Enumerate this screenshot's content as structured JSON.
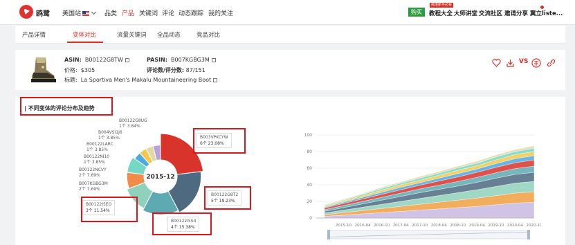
{
  "header": {
    "brand": "鸥鹭",
    "site_label": "美国站",
    "nav": [
      {
        "label": "品类",
        "active": false
      },
      {
        "label": "产品",
        "active": true
      },
      {
        "label": "关键词",
        "active": false
      },
      {
        "label": "评论",
        "active": false
      },
      {
        "label": "动态跟踪",
        "active": false
      },
      {
        "label": "我的关注",
        "active": false
      }
    ],
    "buy_label": "购买",
    "promo_tag": "跨境新手必看",
    "right_nav": [
      "教程大全",
      "大师讲堂",
      "交流社区",
      "邀请分享",
      "翼立liste..."
    ]
  },
  "subnav": {
    "tabs": [
      "产品详情",
      "变体对比",
      "流量关键词",
      "全品动态",
      "竞品对比"
    ],
    "active_index": 1
  },
  "product": {
    "asin_label": "ASIN:",
    "asin": "B00122G8TW",
    "pasin_label": "PASIN:",
    "pasin": "B007KGBG3M",
    "price_label": "价格:",
    "price": "$305",
    "reviews_label": "评论数/评分数:",
    "reviews": "87/151",
    "title_label": "标题:",
    "title": "La Sportiva Men's Makalu Mountaineering Boot",
    "vs_label": "VS"
  },
  "section": {
    "title": "不同变体的评论分布及趋势"
  },
  "chart_data": [
    {
      "type": "pie",
      "center_label": "2015-12",
      "slices": [
        {
          "name": "B003VPKCYW",
          "count": "6个",
          "percent": "23.08%",
          "value": 23.08,
          "color": "#d9342b"
        },
        {
          "name": "B00122G8T2",
          "count": "5个",
          "percent": "19.23%",
          "value": 19.23,
          "color": "#4d6a80"
        },
        {
          "name": "B00122I5S4",
          "count": "4个",
          "percent": "15.38%",
          "value": 15.38,
          "color": "#5eaab3"
        },
        {
          "name": "B00122I5EO",
          "count": "3个",
          "percent": "11.54%",
          "value": 11.54,
          "color": "#8fd1bb"
        },
        {
          "name": "B007KGBG3M",
          "count": "2个",
          "percent": "7.69%",
          "value": 7.69,
          "color": "#f08c4a"
        },
        {
          "name": "B00122NCVY",
          "count": "2个",
          "percent": "7.69%",
          "value": 7.69,
          "color": "#76d7c4"
        },
        {
          "name": "B00122NI10",
          "count": "1个",
          "percent": "3.85%",
          "value": 3.85,
          "color": "#4fa8e0"
        },
        {
          "name": "B00122LARC",
          "count": "1个",
          "percent": "3.85%",
          "value": 3.85,
          "color": "#f2c94c"
        },
        {
          "name": "B004VSI1J6",
          "count": "1个",
          "percent": "3.85%",
          "value": 3.85,
          "color": "#e3d9a8"
        },
        {
          "name": "B00122G8UG",
          "count": "1个",
          "percent": "3.84%",
          "value": 3.84,
          "color": "#b8a3d6"
        }
      ]
    },
    {
      "type": "area",
      "x_ticks": [
        "2015-04",
        "2015-10",
        "2016-04",
        "2016-10",
        "2017-04",
        "2017-10",
        "2018-04",
        "2018-10",
        "2019-04",
        "2019-10",
        "2020-04",
        "2020-10"
      ],
      "y_ticks": [
        0,
        20,
        40,
        60,
        80,
        100
      ],
      "ylim": [
        0,
        100
      ],
      "series_colors": [
        "#c9b8e0",
        "#f0a040",
        "#8fd1bb",
        "#4d6a80",
        "#5eaab3",
        "#d9342b",
        "#4fa8e0",
        "#f2c94c",
        "#76d7c4",
        "#e3d9a8"
      ],
      "series": [
        {
          "values": [
            2,
            3.5,
            5,
            6.5,
            8,
            9.5,
            11,
            12.5,
            14,
            16,
            18,
            19
          ]
        },
        {
          "values": [
            2,
            3,
            4,
            5,
            6,
            7,
            8,
            9,
            10,
            11,
            12,
            12.5
          ]
        },
        {
          "values": [
            2,
            3,
            4,
            5,
            6,
            7,
            8,
            9,
            10,
            11,
            12,
            12.5
          ]
        },
        {
          "values": [
            2,
            3,
            4,
            5,
            6,
            7,
            7.5,
            8,
            9,
            10,
            10.5,
            11
          ]
        },
        {
          "values": [
            2,
            2.5,
            3,
            3.5,
            4,
            4.5,
            5,
            5.5,
            6,
            6.5,
            7,
            7.5
          ]
        },
        {
          "values": [
            2,
            2.5,
            3,
            3.5,
            4,
            4.5,
            5,
            5.5,
            6,
            6.5,
            7,
            7.5
          ]
        },
        {
          "values": [
            1,
            1.5,
            2,
            2.5,
            3,
            3,
            3.5,
            4,
            4,
            4.5,
            5,
            5
          ]
        },
        {
          "values": [
            1,
            1.5,
            2,
            2.5,
            3,
            3,
            3.5,
            4,
            4,
            4.5,
            5,
            5
          ]
        },
        {
          "values": [
            1,
            1,
            1.5,
            2,
            2,
            2.5,
            2.5,
            3,
            3,
            3.5,
            3.5,
            4
          ]
        },
        {
          "values": [
            1,
            1,
            1,
            1.5,
            1.5,
            2,
            2,
            2,
            2.5,
            2.5,
            2.5,
            3
          ]
        }
      ]
    }
  ]
}
